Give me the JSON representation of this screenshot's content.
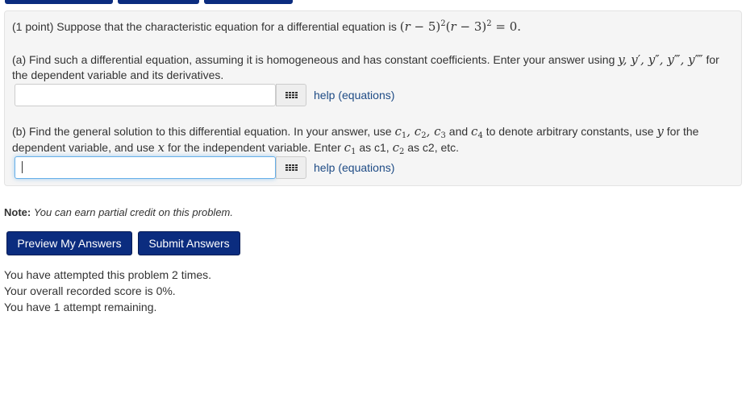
{
  "problem": {
    "intro": "(1 point) Suppose that the characteristic equation for a differential equation is",
    "part_a": {
      "text1": "(a) Find such a differential equation, assuming it is homogeneous and has constant coefficients. Enter your answer using",
      "text1_end": "for",
      "text2": "the dependent variable and its derivatives.",
      "input_value": "",
      "help_label": "help (equations)"
    },
    "part_b": {
      "text1": "(b) Find the general solution to this differential equation. In your answer, use",
      "and": "and",
      "text1_end": "to denote arbitrary constants, use",
      "for": "for the",
      "text2a": "dependent variable, and use",
      "text2b": "for the independent variable. Enter",
      "as_c1": "as c1,",
      "as_c2": "as c2, etc.",
      "input_value": "",
      "help_label": "help (equations)"
    }
  },
  "note": {
    "label": "Note:",
    "text": "You can earn partial credit on this problem."
  },
  "buttons": {
    "preview": "Preview My Answers",
    "submit": "Submit Answers"
  },
  "status": {
    "attempted": "You have attempted this problem 2 times.",
    "score": "Your overall recorded score is 0%.",
    "remaining": "You have 1 attempt remaining."
  },
  "colors": {
    "button_bg": "#0b2c7f",
    "link": "#1e4b85",
    "panel_bg": "#f5f5f5",
    "focus_border": "#66afe9"
  },
  "icons": {
    "equation_editor": "grid-icon"
  }
}
